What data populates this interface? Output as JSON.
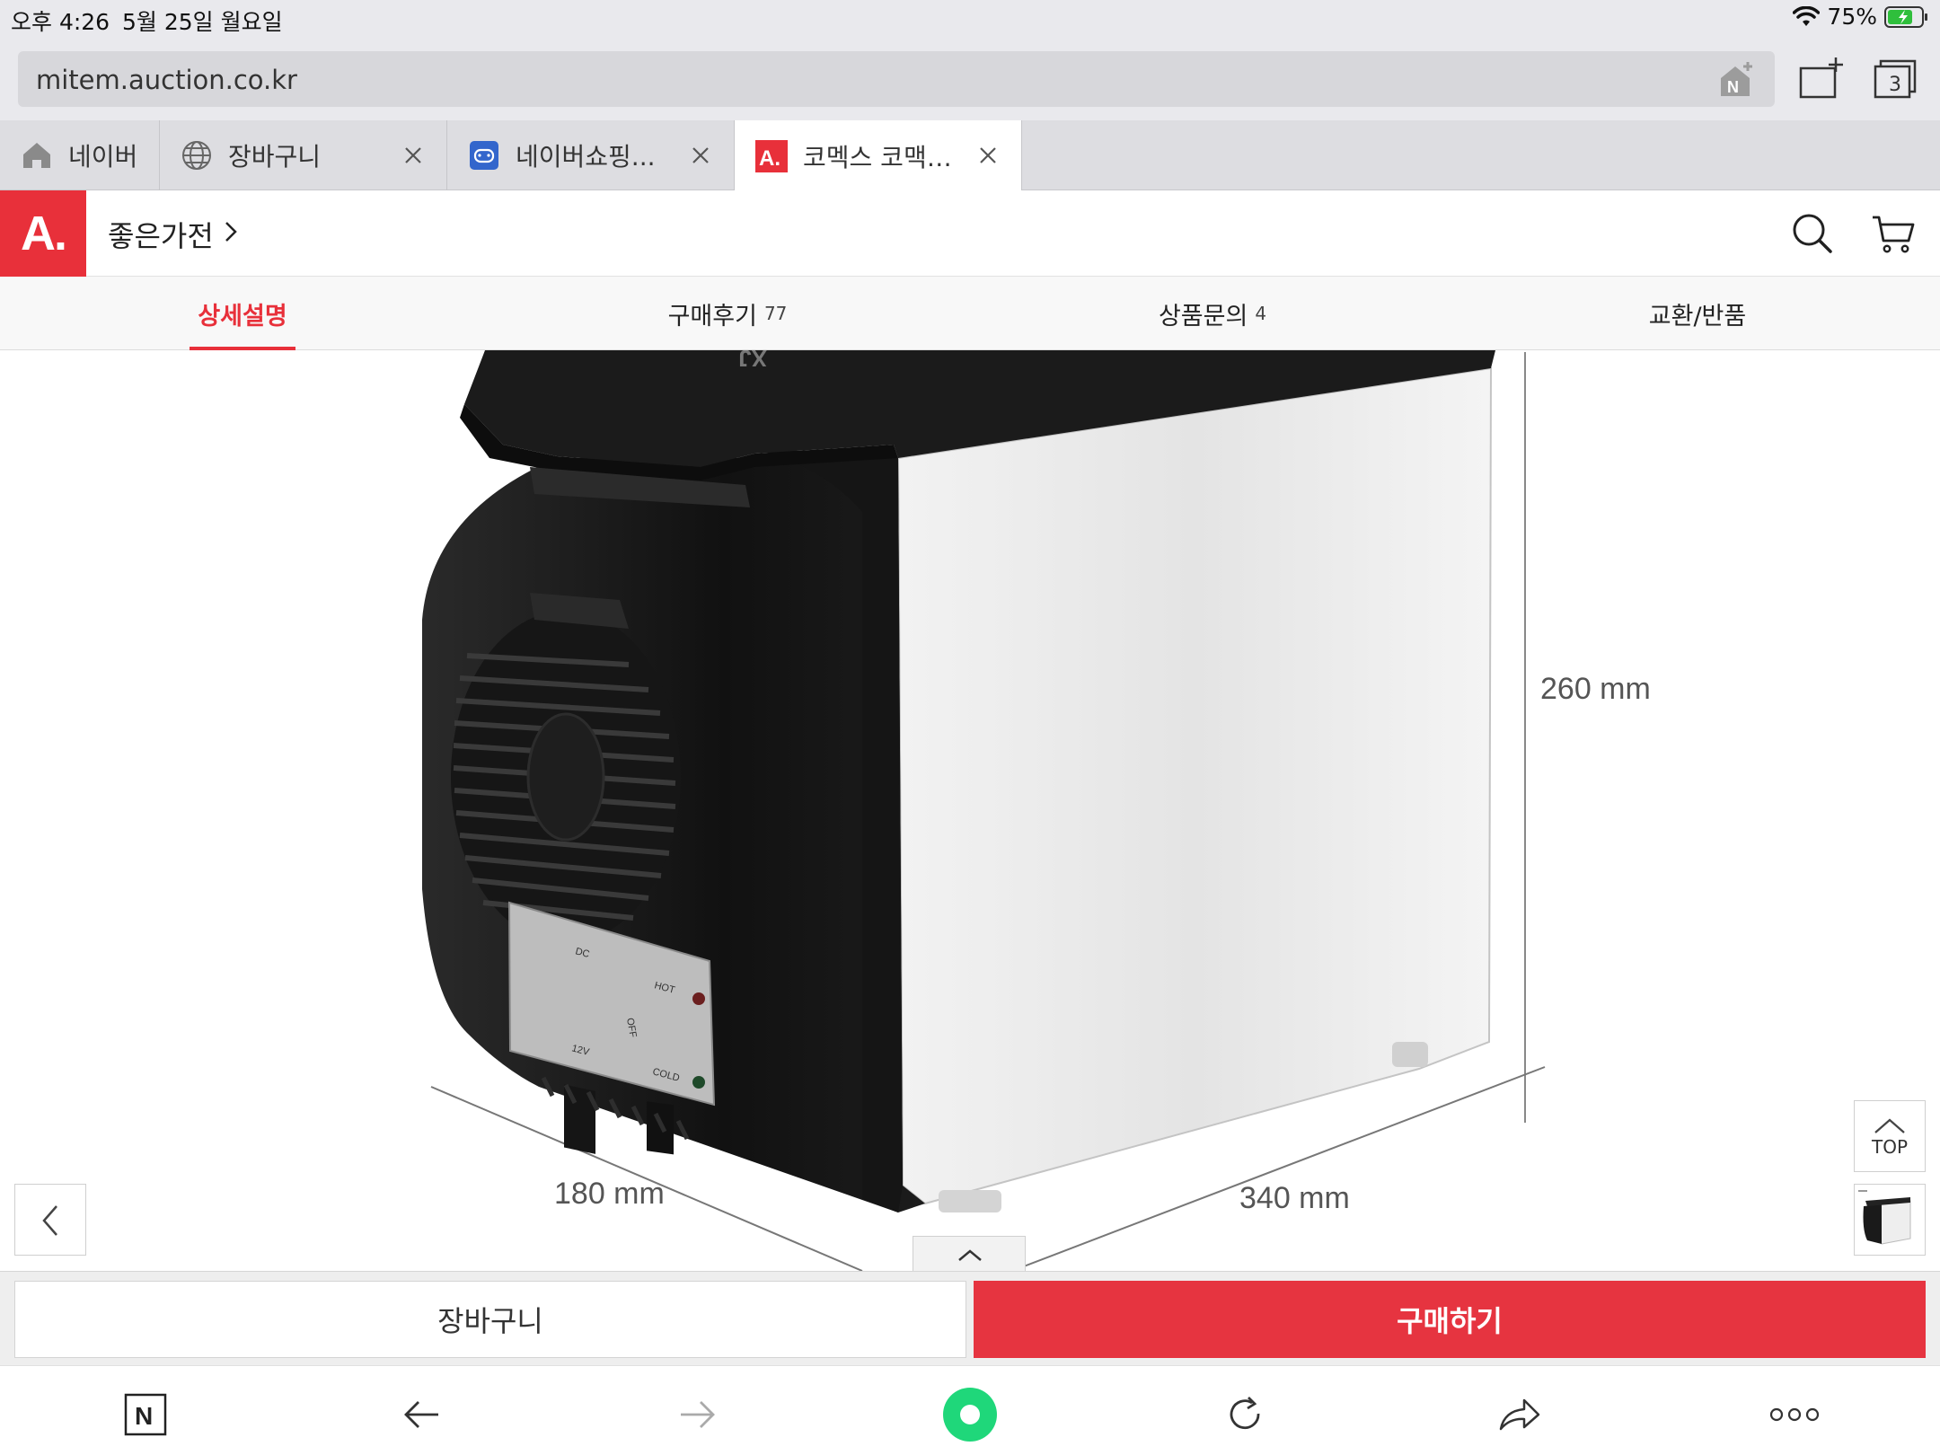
{
  "status_bar": {
    "time": "오후 4:26",
    "date": "5월 25일 월요일",
    "battery_percent": "75%",
    "battery_level": 0.75
  },
  "address_bar": {
    "url": "mitem.auction.co.kr",
    "tab_count": "3"
  },
  "tabs": [
    {
      "label": "네이버",
      "icon": "home-icon",
      "active": false
    },
    {
      "label": "장바구니",
      "icon": "globe-icon",
      "active": false
    },
    {
      "label": "네이버쇼핑...",
      "icon": "gamepad-icon",
      "active": false
    },
    {
      "label": "코멕스 코맥…",
      "icon": "auction-logo-icon",
      "active": true
    }
  ],
  "site_header": {
    "logo": "A.",
    "category": "좋은가전"
  },
  "section_tabs": [
    {
      "label": "상세설명",
      "count": ""
    },
    {
      "label": "구매후기",
      "count": "77"
    },
    {
      "label": "상품문의",
      "count": "4"
    },
    {
      "label": "교환/반품",
      "count": ""
    }
  ],
  "product_image": {
    "height_label": "260 mm",
    "depth_label": "180 mm",
    "width_label": "340 mm",
    "panel_dc": "DC",
    "panel_12v": "12V",
    "panel_hot": "HOT",
    "panel_off": "OFF",
    "panel_cold": "COLD"
  },
  "floating": {
    "top_label": "TOP"
  },
  "buy_bar": {
    "cart_label": "장바구니",
    "buy_label": "구매하기"
  },
  "colors": {
    "brand_red": "#e8303a",
    "buy_red": "#e63440",
    "green_button": "#1fd77a"
  }
}
